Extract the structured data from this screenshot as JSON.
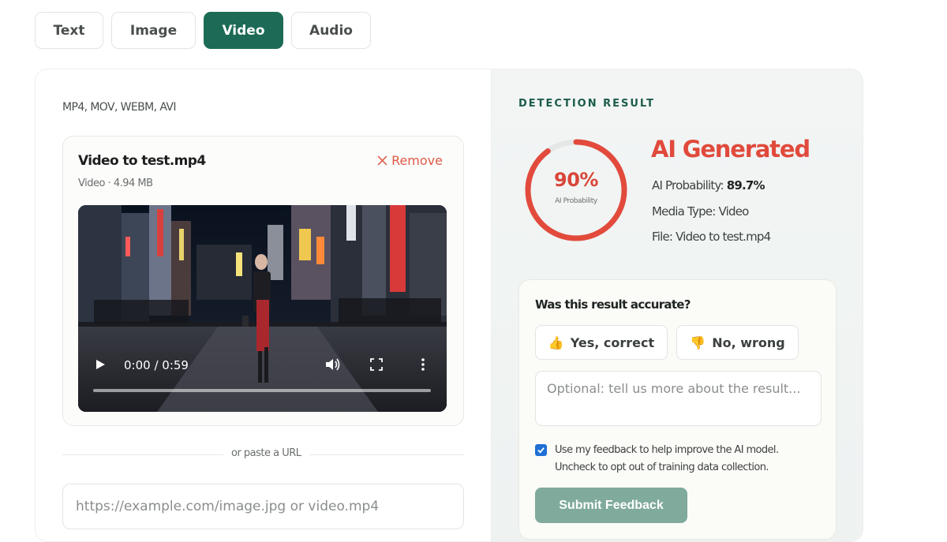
{
  "tabs": [
    {
      "label": "Text"
    },
    {
      "label": "Image"
    },
    {
      "label": "Video"
    },
    {
      "label": "Audio"
    }
  ],
  "upload": {
    "formats": "MP4, MOV, WEBM, AVI",
    "file_name": "Video to test.mp4",
    "file_meta": "Video · 4.94 MB",
    "remove_label": "Remove",
    "player": {
      "time": "0:00 / 0:59",
      "progress_fraction": 0
    },
    "divider_label": "or paste a URL",
    "url_placeholder": "https://example.com/image.jpg or video.mp4"
  },
  "result": {
    "section_title": "DETECTION RESULT",
    "percent_label": "90%",
    "percent_value": 0.9,
    "percent_sub": "AI Probability",
    "verdict": "AI Generated",
    "probability_label": "AI Probability:",
    "probability_value": "89.7%",
    "media_type": "Media Type: Video",
    "file": "File: Video to test.mp4"
  },
  "feedback": {
    "question": "Was this result accurate?",
    "yes_label": "Yes, correct",
    "yes_icon": "👍",
    "no_label": "No, wrong",
    "no_icon": "👎",
    "comment_placeholder": "Optional: tell us more about the result...",
    "consent_checked": true,
    "consent_line1": "Use my feedback to help improve the AI model.",
    "consent_line2": "Uncheck to opt out of training data collection.",
    "submit_label": "Submit Feedback"
  },
  "colors": {
    "accent": "#1d6b57",
    "danger": "#e04a3c",
    "submit": "#7faa9c",
    "checkbox": "#1f6fd6"
  }
}
